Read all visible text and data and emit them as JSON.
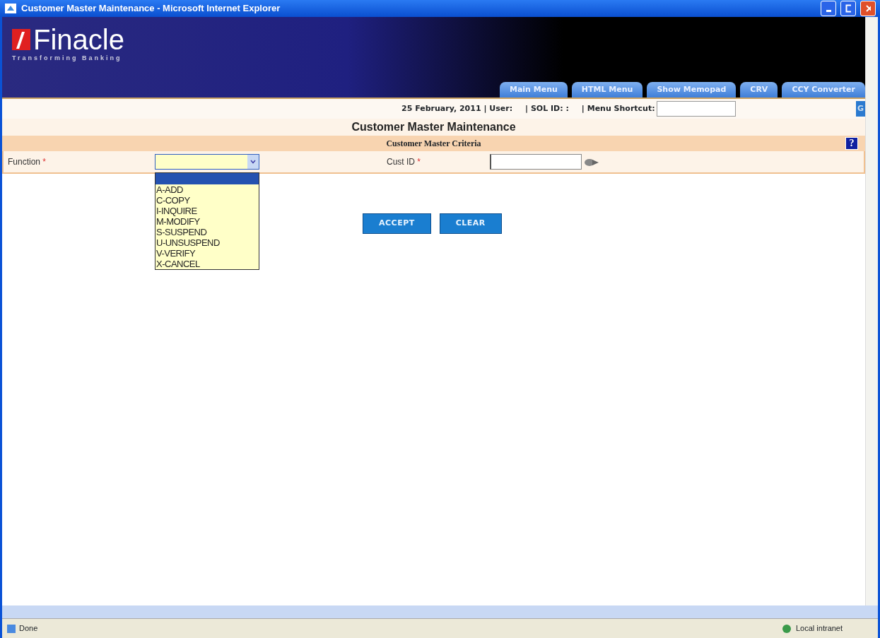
{
  "window": {
    "title": "Customer Master Maintenance - Microsoft Internet Explorer"
  },
  "logo": {
    "name": "Finacle",
    "tagline": "Transforming Banking"
  },
  "tabs": [
    {
      "label": "Main Menu"
    },
    {
      "label": "HTML Menu"
    },
    {
      "label": "Show Memopad"
    },
    {
      "label": "CRV"
    },
    {
      "label": "CCY Converter"
    }
  ],
  "info_bar": {
    "date_user": "25 February, 2011 | User:",
    "sol_id": "| SOL ID: :",
    "shortcut_label": "| Menu Shortcut:",
    "go_button": "G"
  },
  "page_title": "Customer Master Maintenance",
  "section_title": "Customer Master Criteria",
  "help_button": "?",
  "fields": [
    {
      "label": "Function",
      "required_mark": "*"
    },
    {
      "label": "Cust ID",
      "required_mark": "*"
    }
  ],
  "function_dropdown": {
    "expanded": true,
    "blank_option_selected": true,
    "options": [
      {
        "label": "A-ADD",
        "selected": false
      },
      {
        "label": "C-COPY",
        "selected": false
      },
      {
        "label": "I-INQUIRE",
        "selected": false
      },
      {
        "label": "M-MODIFY",
        "selected": false
      },
      {
        "label": "S-SUSPEND",
        "selected": false
      },
      {
        "label": "U-UNSUSPEND",
        "selected": false
      },
      {
        "label": "V-VERIFY",
        "selected": false
      },
      {
        "label": "X-CANCEL",
        "selected": false
      }
    ]
  },
  "buttons": [
    "ACCEPT",
    "CLEAR"
  ],
  "status_bar": {
    "text": "Done",
    "zone": "Local intranet"
  }
}
